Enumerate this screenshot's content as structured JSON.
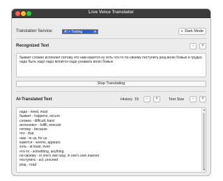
{
  "window": {
    "title": "Live Voice Translator"
  },
  "service": {
    "label": "Translation Service:",
    "selected": "AI + Testing"
  },
  "dark_mode": {
    "icon": "half-moon",
    "label": "Dark Mode"
  },
  "recognized": {
    "title": "Recognized Text",
    "minus": "-",
    "plus": "+",
    "text": "бывает сложно испоняют потому что нам кажется ну хоть что-то по-своему поступить рощ волю божью и трудно надо быть надо надо молится надо узнавать волю божью"
  },
  "stop_button": "Stop Translating",
  "translated": {
    "title": "AI-Translated Text",
    "history_label": "History",
    "history_value": "15",
    "minus": "-",
    "plus": "+",
    "text_size_label": "Text Size",
    "lines": [
      "надо - need, must",
      "бывает - happens, occurs",
      "сложно - difficult, hard",
      "исполняют - fulfill, execute",
      "потому - because",
      "что - that",
      "нам - to us, for us",
      "кажется - seems, appears",
      "хоть - at least, even",
      "что-то - something, anything",
      "по-своему - in one's own way, in one's own manner",
      "поступить - act, proceed",
      "рощ - road"
    ]
  }
}
